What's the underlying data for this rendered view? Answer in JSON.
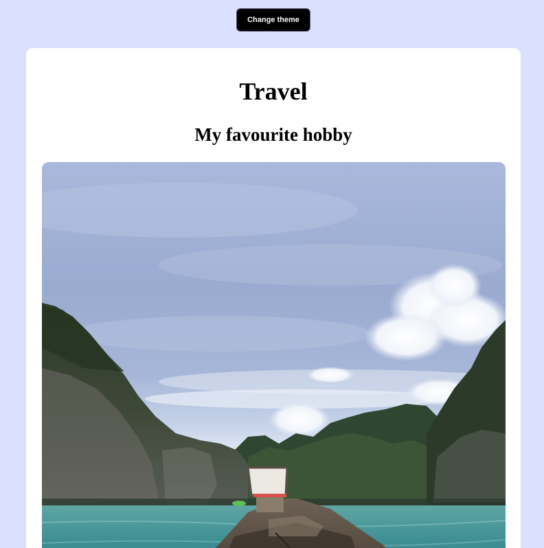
{
  "header": {
    "theme_button_label": "Change theme"
  },
  "card": {
    "title": "Travel",
    "subtitle": "My favourite hobby"
  },
  "colors": {
    "page_background": "#dbe0ff",
    "card_background": "#ffffff",
    "button_background": "#000000",
    "button_text": "#ffffff"
  }
}
